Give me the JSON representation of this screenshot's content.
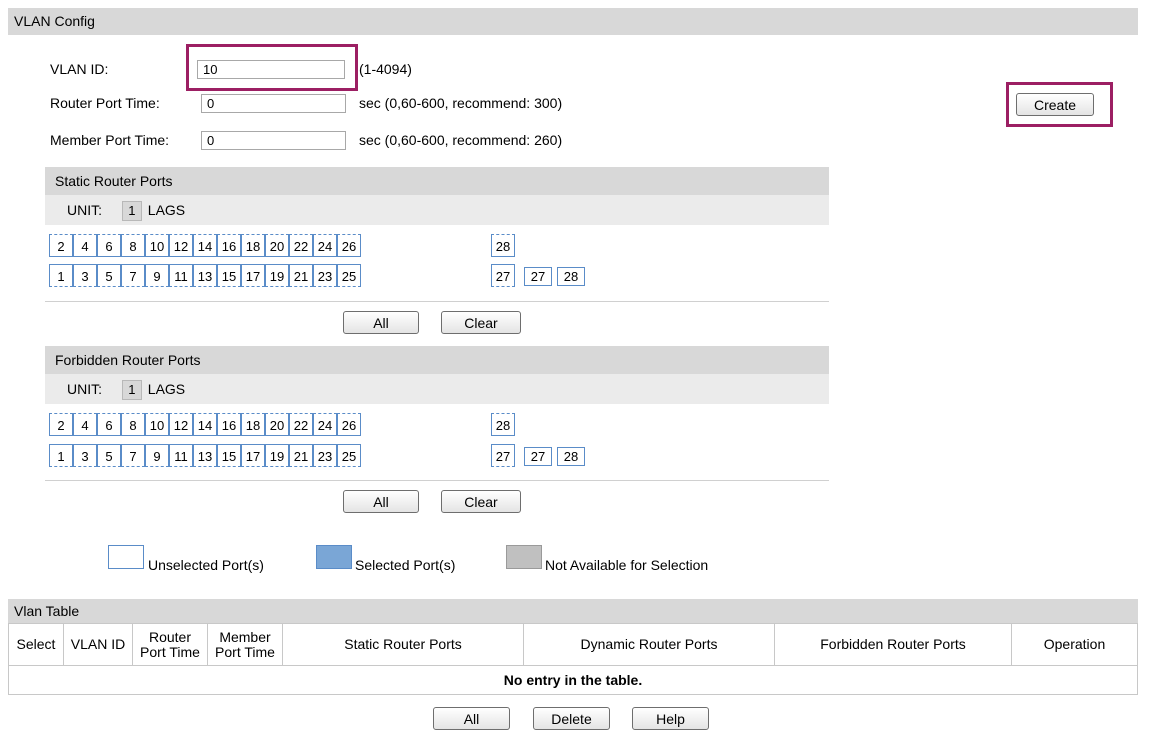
{
  "vlan_config": {
    "section_title": "VLAN Config",
    "vlan_id_label": "VLAN ID:",
    "vlan_id_value": "10",
    "vlan_id_hint": "(1-4094)",
    "router_time_label": "Router Port Time:",
    "router_time_value": "0",
    "router_time_hint": "sec (0,60-600, recommend: 300)",
    "member_time_label": "Member Port Time:",
    "member_time_value": "0",
    "member_time_hint": "sec (0,60-600, recommend: 260)",
    "create_label": "Create"
  },
  "static_router": {
    "title": "Static Router Ports",
    "unit_label": "UNIT:",
    "unit_value": "1",
    "lags_label": "LAGS",
    "all_label": "All",
    "clear_label": "Clear"
  },
  "forbidden_router": {
    "title": "Forbidden Router Ports",
    "unit_label": "UNIT:",
    "unit_value": "1",
    "lags_label": "LAGS",
    "all_label": "All",
    "clear_label": "Clear"
  },
  "ports": {
    "top_row": [
      "2",
      "4",
      "6",
      "8",
      "10",
      "12",
      "14",
      "16",
      "18",
      "20",
      "22",
      "24",
      "26"
    ],
    "bottom_row": [
      "1",
      "3",
      "5",
      "7",
      "9",
      "11",
      "13",
      "15",
      "17",
      "19",
      "21",
      "23",
      "25"
    ],
    "extra_top": "28",
    "extra_bottom": "27",
    "lag_ports": [
      "27",
      "28"
    ]
  },
  "legend": {
    "unselected": "Unselected Port(s)",
    "selected": "Selected Port(s)",
    "not_available": "Not Available for Selection",
    "colors": {
      "port_border": "#5a8cc8",
      "selected_fill": "#7aa6d6",
      "not_available_fill": "#c0c0c0",
      "highlight": "#9c1f63"
    }
  },
  "vlan_table": {
    "title": "Vlan Table",
    "columns": {
      "select": "Select",
      "vlan_id": "VLAN ID",
      "router_time_1": "Router",
      "router_time_2": "Port Time",
      "member_time_1": "Member",
      "member_time_2": "Port Time",
      "static_ports": "Static Router Ports",
      "dynamic_ports": "Dynamic Router Ports",
      "forbidden_ports": "Forbidden Router Ports",
      "operation": "Operation"
    },
    "empty_text": "No entry in the table.",
    "all_label": "All",
    "delete_label": "Delete",
    "help_label": "Help"
  }
}
